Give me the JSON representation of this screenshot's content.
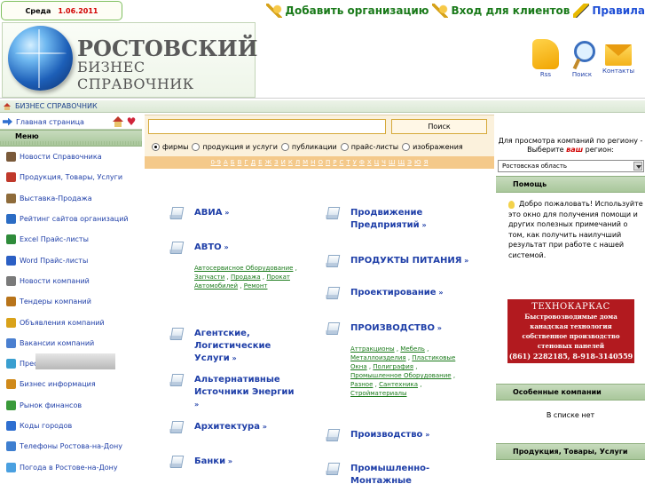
{
  "date": {
    "day": "Среда",
    "value": "1.06.2011"
  },
  "top_links": {
    "add_org": "Добавить организацию",
    "login": "Вход для клиентов",
    "rules": "Правила"
  },
  "logo": {
    "title": "РОСТОВСКИЙ",
    "subtitle": "БИЗНЕС СПРАВОЧНИК"
  },
  "header_icons": [
    {
      "label": "Rss",
      "icon": "rss-icon"
    },
    {
      "label": "Поиск",
      "icon": "magnifier-icon"
    },
    {
      "label": "Контакты",
      "icon": "envelope-icon"
    }
  ],
  "breadcrumb": "БИЗНЕС СПРАВОЧНИК",
  "sidebar": {
    "home_link": "Главная страница",
    "menu_title": "Меню",
    "items": [
      {
        "label": "Новости Справочника",
        "color": "#7a5a3a"
      },
      {
        "label": "Продукция, Товары, Услуги",
        "color": "#c0392b"
      },
      {
        "label": "Выставка-Продажа",
        "color": "#8e6b3a"
      },
      {
        "label": "Рейтинг сайтов организаций",
        "color": "#2b6cc4"
      },
      {
        "label": "Excel Прайс-листы",
        "color": "#2e8b3a"
      },
      {
        "label": "Word Прайс-листы",
        "color": "#2b5fc4"
      },
      {
        "label": "Новости компаний",
        "color": "#7a7a7a"
      },
      {
        "label": "Тендеры компаний",
        "color": "#b8741a"
      },
      {
        "label": "Объявления компаний",
        "color": "#d9a21a"
      },
      {
        "label": "Вакансии компаний",
        "color": "#4a7fd0"
      },
      {
        "label": "Пресс-релизы компаний",
        "color": "#3a9fd0"
      },
      {
        "label": "Бизнес информация",
        "color": "#d08a1a"
      },
      {
        "label": "Рынок финансов",
        "color": "#3a9a3a"
      },
      {
        "label": "Коды городов",
        "color": "#2f6fd0"
      },
      {
        "label": "Телефоны Ростова-на-Дону",
        "color": "#3f7fd0"
      },
      {
        "label": "Погода в Ростове-на-Дону",
        "color": "#4aa0e0"
      }
    ]
  },
  "search": {
    "value": "",
    "button": "Поиск"
  },
  "search_types": [
    {
      "label": "фирмы",
      "selected": true
    },
    {
      "label": "продукция и услуги",
      "selected": false
    },
    {
      "label": "публикации",
      "selected": false
    },
    {
      "label": "прайс-листы",
      "selected": false
    },
    {
      "label": "изображения",
      "selected": false
    }
  ],
  "alphabet": [
    "0-9",
    "А",
    "Б",
    "В",
    "Г",
    "Д",
    "Е",
    "Ж",
    "З",
    "И",
    "К",
    "Л",
    "М",
    "Н",
    "О",
    "П",
    "Р",
    "С",
    "Т",
    "У",
    "Ф",
    "Х",
    "Ц",
    "Ч",
    "Ш",
    "Щ",
    "Э",
    "Ю",
    "Я"
  ],
  "categories_left": [
    {
      "name": "АВИА",
      "subs": []
    },
    {
      "name": "АВТО",
      "subs": [
        "Автосервисное Оборудование",
        "Запчасти",
        "Продажа",
        "Прокат Автомобилей",
        "Ремонт"
      ]
    },
    {
      "name": "Агентские, Логистические Услуги",
      "subs": []
    },
    {
      "name": "Альтернативные Источники Энергии",
      "subs": []
    },
    {
      "name": "Архитектура",
      "subs": []
    },
    {
      "name": "Банки",
      "subs": []
    }
  ],
  "categories_right": [
    {
      "name": "Продвижение Предприятий",
      "subs": []
    },
    {
      "name": "ПРОДУКТЫ ПИТАНИЯ",
      "subs": []
    },
    {
      "name": "Проектирование",
      "subs": []
    },
    {
      "name": "ПРОИЗВОДСТВО",
      "subs": [
        "Аттракционы",
        "Мебель",
        "Металлоизделия",
        "Пластиковые Окна",
        "Полиграфия",
        "Промышленное Оборудование",
        "Разное",
        "Сантехника",
        "Стройматериалы"
      ]
    },
    {
      "name": "Производство",
      "subs": []
    },
    {
      "name": "Промышленно-Монтажные Предприятия",
      "subs": []
    }
  ],
  "right": {
    "region_prompt_1": "Для просмотра компаний по региону -",
    "region_prompt_2": "Выберите",
    "region_prompt_your": "ваш",
    "region_prompt_3": "регион:",
    "region_value": "Ростовская область",
    "help_title": "Помощь",
    "help_text": "Добро пожаловать! Используйте это окно для получения помощи и других полезных примечаний о том, как получить наилучший результат при работе с нашей системой.",
    "banner": {
      "title": "ТЕХНОКАРКАС",
      "line1": "Быстровозводимые дома",
      "line2": "канадская технология",
      "line3": "собственное производство",
      "line4": "стеновых панелей",
      "phones": "(861) 2282185, 8-918-3140559"
    },
    "special_title": "Особенные компании",
    "special_empty": "В списке нет",
    "products_title": "Продукция, Товары, Услуги"
  },
  "colors": {
    "accent_green": "#1a7a1a",
    "link_blue": "#1f3fa8",
    "banner_red": "#b21a1f"
  }
}
